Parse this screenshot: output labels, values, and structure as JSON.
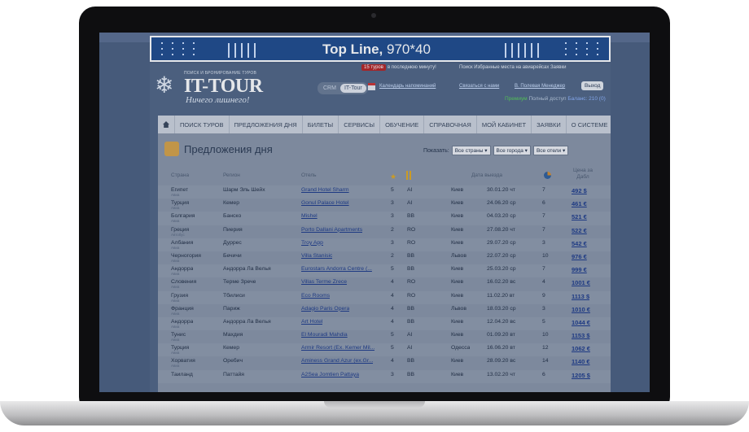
{
  "banner": {
    "title_bold": "Top Line,",
    "title_rest": " 970*40"
  },
  "header": {
    "logo_tag": "ПОИСК И БРОНИРОВАНИЕ ТУРОВ",
    "logo": "IT-TOUR",
    "slogan": "Ничего лишнего!",
    "hot_badge": "15 туров",
    "hot_text": "в последнюю минуту!",
    "top_links": "Поиск   Избранные места на авиарейсах   Заявки",
    "tab_crm": "CRM",
    "tab_ittour": "IT-Tour",
    "calendar_link": "Календарь напоминаний",
    "contact_link": "Связаться с нами",
    "manager_link": "В. Полевая Менеджер",
    "exit_button": "Выход",
    "info_green": "Премиум",
    "info_text": "Полный доступ",
    "info_balance": "Баланс: 210 (0)"
  },
  "menu": [
    "ПОИСК ТУРОВ",
    "ПРЕДЛОЖЕНИЯ ДНЯ",
    "БИЛЕТЫ",
    "СЕРВИСЫ",
    "ОБУЧЕНИЕ",
    "СПРАВОЧНАЯ",
    "МОЙ КАБИНЕТ",
    "ЗАЯВКИ",
    "О СИСТЕМЕ"
  ],
  "page": {
    "title": "Предложения дня",
    "show_label": "Показать:",
    "filter_country": "Все страны",
    "filter_city": "Все города",
    "filter_hotel": "Все отели"
  },
  "columns": {
    "country": "Страна",
    "region": "Регион",
    "hotel": "Отель",
    "date": "Дата выезда",
    "price": "Цена за Дабл"
  },
  "rows": [
    {
      "country": "Египет",
      "sub": "Авиа",
      "region": "Шарм Эль Шейх",
      "hotel": "Grand Hotel Sharm",
      "stars": "5",
      "meal": "AI",
      "city": "Киев",
      "date": "30.01.20 чт",
      "nights": "7",
      "price": "492 $"
    },
    {
      "country": "Турция",
      "sub": "Авиа",
      "region": "Кемер",
      "hotel": "Gonul Palace Hotel",
      "stars": "3",
      "meal": "AI",
      "city": "Киев",
      "date": "24.06.20 ср",
      "nights": "6",
      "price": "461 €"
    },
    {
      "country": "Болгария",
      "sub": "Авиа",
      "region": "Банско",
      "hotel": "Mishel",
      "stars": "3",
      "meal": "BB",
      "city": "Киев",
      "date": "04.03.20 ср",
      "nights": "7",
      "price": "521 €"
    },
    {
      "country": "Греция",
      "sub": "Автобус",
      "region": "Пиерия",
      "hotel": "Porto Dallani Apartments",
      "stars": "2",
      "meal": "RO",
      "city": "Киев",
      "date": "27.08.20 чт",
      "nights": "7",
      "price": "522 €"
    },
    {
      "country": "Албания",
      "sub": "Авиа",
      "region": "Дуррес",
      "hotel": "Troy App",
      "stars": "3",
      "meal": "RO",
      "city": "Киев",
      "date": "29.07.20 ср",
      "nights": "3",
      "price": "542 €"
    },
    {
      "country": "Черногория",
      "sub": "Авиа",
      "region": "Бечичи",
      "hotel": "Villa Stanisic",
      "stars": "2",
      "meal": "BB",
      "city": "Львов",
      "date": "22.07.20 ср",
      "nights": "10",
      "price": "976 €"
    },
    {
      "country": "Андорра",
      "sub": "Авиа",
      "region": "Андорра Ла Велья",
      "hotel": "Eurostars Andorra Centre (...",
      "stars": "5",
      "meal": "BB",
      "city": "Киев",
      "date": "25.03.20 ср",
      "nights": "7",
      "price": "999 €"
    },
    {
      "country": "Словения",
      "sub": "Авиа",
      "region": "Терме Зрече",
      "hotel": "Villas Terme Zrece",
      "stars": "4",
      "meal": "RO",
      "city": "Киев",
      "date": "16.02.20 вс",
      "nights": "4",
      "price": "1001 €"
    },
    {
      "country": "Грузия",
      "sub": "Авиа",
      "region": "Тбилиси",
      "hotel": "Eco Rooms",
      "stars": "4",
      "meal": "RO",
      "city": "Киев",
      "date": "11.02.20 вт",
      "nights": "9",
      "price": "1113 $"
    },
    {
      "country": "Франция",
      "sub": "Авиа",
      "region": "Париж",
      "hotel": "Adagio Paris Opera",
      "stars": "4",
      "meal": "BB",
      "city": "Львов",
      "date": "18.03.20 ср",
      "nights": "3",
      "price": "1010 €"
    },
    {
      "country": "Андорра",
      "sub": "Авиа",
      "region": "Андорра Ла Велья",
      "hotel": "Art Hotel",
      "stars": "4",
      "meal": "BB",
      "city": "Киев",
      "date": "12.04.20 вс",
      "nights": "5",
      "price": "1044 €"
    },
    {
      "country": "Тунис",
      "sub": "Авиа",
      "region": "Махдия",
      "hotel": "El Mouradi Mahdia",
      "stars": "5",
      "meal": "AI",
      "city": "Киев",
      "date": "01.09.20 вт",
      "nights": "10",
      "price": "1153 $"
    },
    {
      "country": "Турция",
      "sub": "Авиа",
      "region": "Кемер",
      "hotel": "Armir Resort (Ex. Kemer Mil...",
      "stars": "5",
      "meal": "AI",
      "city": "Одесса",
      "date": "16.06.20 вт",
      "nights": "12",
      "price": "1062 €"
    },
    {
      "country": "Хорватия",
      "sub": "Авиа",
      "region": "Оребич",
      "hotel": "Aminess Grand Azur (ex.Gr...",
      "stars": "4",
      "meal": "BB",
      "city": "Киев",
      "date": "28.09.20 вс",
      "nights": "14",
      "price": "1140 €"
    },
    {
      "country": "Таиланд",
      "sub": "",
      "region": "Паттайя",
      "hotel": "A2Sea Jomtien Pattaya",
      "stars": "3",
      "meal": "BB",
      "city": "Киев",
      "date": "13.02.20 чт",
      "nights": "6",
      "price": "1205 $"
    }
  ]
}
